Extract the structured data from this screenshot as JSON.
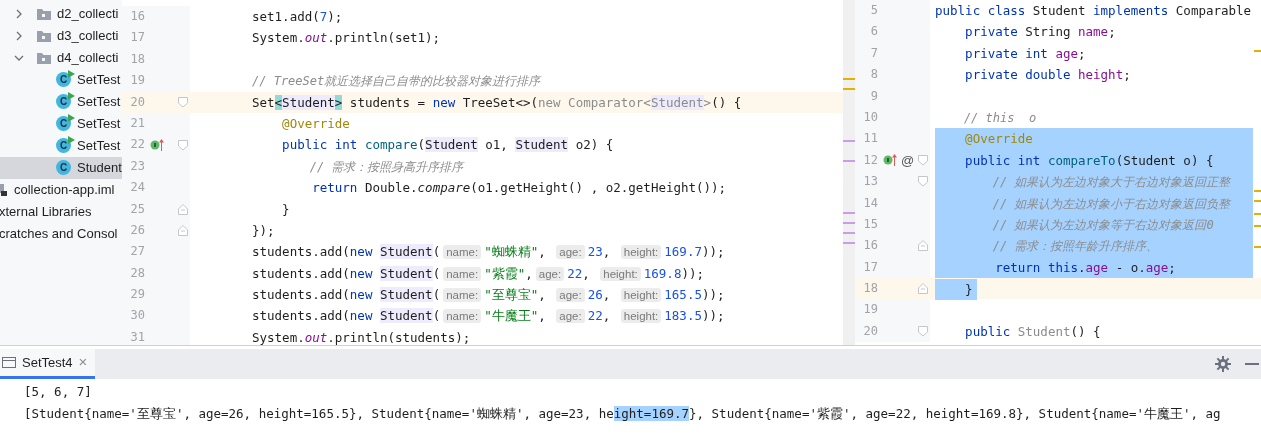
{
  "project_tree": {
    "nested_items": [
      {
        "label": "d2_collecti",
        "kind": "folder",
        "expanded": false,
        "selected": false
      },
      {
        "label": "d3_collecti",
        "kind": "folder",
        "expanded": false,
        "selected": false
      },
      {
        "label": "d4_collecti",
        "kind": "folder",
        "expanded": true,
        "selected": false,
        "children": [
          {
            "label": "SetTest",
            "kind": "class",
            "icon_letter": "C",
            "runnable": true,
            "selected": false
          },
          {
            "label": "SetTest",
            "kind": "class",
            "icon_letter": "C",
            "runnable": true,
            "selected": false
          },
          {
            "label": "SetTest",
            "kind": "class",
            "icon_letter": "C",
            "runnable": true,
            "selected": false
          },
          {
            "label": "SetTest",
            "kind": "class",
            "icon_letter": "C",
            "runnable": true,
            "selected": false
          },
          {
            "label": "Student",
            "kind": "class",
            "icon_letter": "C",
            "runnable": false,
            "selected": true
          }
        ]
      }
    ],
    "items": [
      {
        "label": "collection-app.iml",
        "kind": "module",
        "selected": false
      },
      {
        "label": "xternal Libraries",
        "kind": "plain",
        "selected": false
      },
      {
        "label": "cratches and Consol",
        "kind": "plain",
        "selected": false
      }
    ]
  },
  "left_editor": {
    "lines": [
      {
        "number": "16",
        "tokens": [
          {
            "kind": "plain",
            "text": "set1.add("
          },
          {
            "kind": "num",
            "text": "7"
          },
          {
            "kind": "plain",
            "text": ");"
          }
        ]
      },
      {
        "number": "17",
        "tokens": [
          {
            "kind": "plain",
            "text": "System."
          },
          {
            "kind": "static",
            "text": "out"
          },
          {
            "kind": "plain",
            "text": ".println(set1);"
          }
        ]
      },
      {
        "number": "18"
      },
      {
        "number": "19",
        "tokens": [
          {
            "kind": "comment",
            "text": "// TreeSet就近选择自己自带的比较器对象进行排序"
          }
        ]
      },
      {
        "number": "20",
        "current": true,
        "fold_start": true,
        "tokens": [
          {
            "kind": "plain",
            "text": "Set"
          },
          {
            "kind": "bracket",
            "text": "<"
          },
          {
            "kind": "typeref",
            "text": "Student"
          },
          {
            "kind": "bracket",
            "text": ">"
          },
          {
            "kind": "plain",
            "text": " students = "
          },
          {
            "kind": "kw",
            "text": "new"
          },
          {
            "kind": "plain",
            "text": " TreeSet<>("
          },
          {
            "kind": "dim",
            "text": "new Comparator<"
          },
          {
            "kind": "dimref",
            "text": "Student"
          },
          {
            "kind": "dim",
            "text": ">"
          },
          {
            "kind": "plain",
            "text": "() {"
          }
        ]
      },
      {
        "number": "21",
        "tokens": [
          {
            "kind": "ann",
            "text": "    @Override"
          }
        ]
      },
      {
        "number": "22",
        "implements_marker": true,
        "fold_start": true,
        "tokens": [
          {
            "kind": "kw",
            "text": "    public int "
          },
          {
            "kind": "method",
            "text": "compare"
          },
          {
            "kind": "plain",
            "text": "("
          },
          {
            "kind": "typeref",
            "text": "Student"
          },
          {
            "kind": "plain",
            "text": " o1, "
          },
          {
            "kind": "typeref",
            "text": "Student"
          },
          {
            "kind": "plain",
            "text": " o2) {"
          }
        ]
      },
      {
        "number": "23",
        "tokens": [
          {
            "kind": "comment",
            "text": "        // 需求：按照身高升序排序"
          }
        ]
      },
      {
        "number": "24",
        "tokens": [
          {
            "kind": "kw",
            "text": "        return"
          },
          {
            "kind": "plain",
            "text": " Double."
          },
          {
            "kind": "italic",
            "text": "compare"
          },
          {
            "kind": "plain",
            "text": "(o1.getHeight() , o2.getHeight());"
          }
        ]
      },
      {
        "number": "25",
        "fold_end": true,
        "tokens": [
          {
            "kind": "plain",
            "text": "    }"
          }
        ]
      },
      {
        "number": "26",
        "fold_end": true,
        "tokens": [
          {
            "kind": "plain",
            "text": "});"
          }
        ]
      },
      {
        "number": "27",
        "tokens": [
          {
            "kind": "plain",
            "text": "students.add("
          },
          {
            "kind": "kw",
            "text": "new "
          },
          {
            "kind": "typeref",
            "text": "Student"
          },
          {
            "kind": "plain",
            "text": "("
          },
          {
            "kind": "hint",
            "text": "name:"
          },
          {
            "kind": "str",
            "text": "\"蜘蛛精\""
          },
          {
            "kind": "plain",
            "text": ", "
          },
          {
            "kind": "hint",
            "text": "age:"
          },
          {
            "kind": "num",
            "text": "23"
          },
          {
            "kind": "plain",
            "text": ", "
          },
          {
            "kind": "hint",
            "text": "height:"
          },
          {
            "kind": "num",
            "text": "169.7"
          },
          {
            "kind": "plain",
            "text": "));"
          }
        ]
      },
      {
        "number": "28",
        "tokens": [
          {
            "kind": "plain",
            "text": "students.add("
          },
          {
            "kind": "kw",
            "text": "new "
          },
          {
            "kind": "typeref",
            "text": "Student"
          },
          {
            "kind": "plain",
            "text": "("
          },
          {
            "kind": "hint",
            "text": "name:"
          },
          {
            "kind": "str",
            "text": "\"紫霞\""
          },
          {
            "kind": "plain",
            "text": ","
          },
          {
            "kind": "hint",
            "text": "age:"
          },
          {
            "kind": "num",
            "text": "22"
          },
          {
            "kind": "plain",
            "text": ", "
          },
          {
            "kind": "hint",
            "text": "height:"
          },
          {
            "kind": "num",
            "text": "169.8"
          },
          {
            "kind": "plain",
            "text": "));"
          }
        ]
      },
      {
        "number": "29",
        "tokens": [
          {
            "kind": "plain",
            "text": "students.add("
          },
          {
            "kind": "kw",
            "text": "new "
          },
          {
            "kind": "typeref",
            "text": "Student"
          },
          {
            "kind": "plain",
            "text": "("
          },
          {
            "kind": "hint",
            "text": "name:"
          },
          {
            "kind": "str",
            "text": "\"至尊宝\""
          },
          {
            "kind": "plain",
            "text": ", "
          },
          {
            "kind": "hint",
            "text": "age:"
          },
          {
            "kind": "num",
            "text": "26"
          },
          {
            "kind": "plain",
            "text": ", "
          },
          {
            "kind": "hint",
            "text": "height:"
          },
          {
            "kind": "num",
            "text": "165.5"
          },
          {
            "kind": "plain",
            "text": "));"
          }
        ]
      },
      {
        "number": "30",
        "tokens": [
          {
            "kind": "plain",
            "text": "students.add("
          },
          {
            "kind": "kw",
            "text": "new "
          },
          {
            "kind": "typeref",
            "text": "Student"
          },
          {
            "kind": "plain",
            "text": "("
          },
          {
            "kind": "hint",
            "text": "name:"
          },
          {
            "kind": "str",
            "text": "\"牛魔王\""
          },
          {
            "kind": "plain",
            "text": ", "
          },
          {
            "kind": "hint",
            "text": "age:"
          },
          {
            "kind": "num",
            "text": "22"
          },
          {
            "kind": "plain",
            "text": ", "
          },
          {
            "kind": "hint",
            "text": "height:"
          },
          {
            "kind": "num",
            "text": "183.5"
          },
          {
            "kind": "plain",
            "text": "));"
          }
        ]
      },
      {
        "number": "31",
        "tokens": [
          {
            "kind": "plain",
            "text": "System."
          },
          {
            "kind": "static",
            "text": "out"
          },
          {
            "kind": "plain",
            "text": ".println(students);"
          }
        ]
      }
    ]
  },
  "right_editor": {
    "lines": [
      {
        "number": "5",
        "tokens": [
          {
            "kind": "kw",
            "text": "public class"
          },
          {
            "kind": "plain",
            "text": " Student "
          },
          {
            "kind": "kw",
            "text": "implements"
          },
          {
            "kind": "plain",
            "text": " Comparable"
          }
        ]
      },
      {
        "number": "6",
        "tokens": [
          {
            "kind": "kw",
            "text": "    private"
          },
          {
            "kind": "plain",
            "text": " String "
          },
          {
            "kind": "field",
            "text": "name"
          },
          {
            "kind": "plain",
            "text": ";"
          }
        ]
      },
      {
        "number": "7",
        "tokens": [
          {
            "kind": "kw",
            "text": "    private int "
          },
          {
            "kind": "field",
            "text": "age"
          },
          {
            "kind": "plain",
            "text": ";"
          }
        ]
      },
      {
        "number": "8",
        "tokens": [
          {
            "kind": "kw",
            "text": "    private double "
          },
          {
            "kind": "field",
            "text": "height"
          },
          {
            "kind": "plain",
            "text": ";"
          }
        ]
      },
      {
        "number": "9"
      },
      {
        "number": "10",
        "tokens": [
          {
            "kind": "comment",
            "text": "    // this  o"
          }
        ]
      },
      {
        "number": "11",
        "selected": true,
        "tokens": [
          {
            "kind": "ann",
            "text": "    @Override"
          }
        ]
      },
      {
        "number": "12",
        "selected": true,
        "implements_marker": true,
        "marker_glyph": "@",
        "fold_start": true,
        "tokens": [
          {
            "kind": "kw",
            "text": "    public int "
          },
          {
            "kind": "method",
            "text": "compareTo"
          },
          {
            "kind": "plain",
            "text": "(Student o) {"
          }
        ]
      },
      {
        "number": "13",
        "selected": true,
        "fold_start": true,
        "tokens": [
          {
            "kind": "comment",
            "text": "        // 如果认为左边对象大于右边对象返回正整"
          }
        ]
      },
      {
        "number": "14",
        "selected": true,
        "tokens": [
          {
            "kind": "comment",
            "text": "        // 如果认为左边对象小于右边对象返回负整"
          }
        ]
      },
      {
        "number": "15",
        "selected": true,
        "tokens": [
          {
            "kind": "comment",
            "text": "        // 如果认为左边对象等于右边对象返回0"
          }
        ]
      },
      {
        "number": "16",
        "selected": true,
        "fold_end": true,
        "tokens": [
          {
            "kind": "comment",
            "text": "        // 需求：按照年龄升序排序、"
          }
        ]
      },
      {
        "number": "17",
        "selected": true,
        "tokens": [
          {
            "kind": "kw",
            "text": "        return this"
          },
          {
            "kind": "plain",
            "text": "."
          },
          {
            "kind": "field",
            "text": "age"
          },
          {
            "kind": "plain",
            "text": " - o."
          },
          {
            "kind": "field",
            "text": "age"
          },
          {
            "kind": "plain",
            "text": ";"
          }
        ]
      },
      {
        "number": "18",
        "selected": true,
        "current": true,
        "fold_end": true,
        "tokens": [
          {
            "kind": "plain",
            "text": "    }"
          }
        ]
      },
      {
        "number": "19"
      },
      {
        "number": "20",
        "fold_start": true,
        "tokens": [
          {
            "kind": "kw",
            "text": "    public "
          },
          {
            "kind": "dim",
            "text": "Student"
          },
          {
            "kind": "plain",
            "text": "() {"
          }
        ]
      }
    ]
  },
  "run_panel": {
    "tabs": [
      {
        "label": "SetTest4",
        "close": "×",
        "selected": true
      }
    ],
    "output": [
      [
        {
          "text": "[5, 6, 7]",
          "selected": false
        }
      ],
      [
        {
          "text": "[Student{name='至尊宝', age=26, height=165.5}, Student{name='蜘蛛精', age=23, he",
          "selected": false
        },
        {
          "text": "ight=169.7",
          "selected": true
        },
        {
          "text": "}, Student{name='紫霞', age=22, height=169.8}, Student{name='牛魔王', ag",
          "selected": false
        }
      ]
    ]
  }
}
